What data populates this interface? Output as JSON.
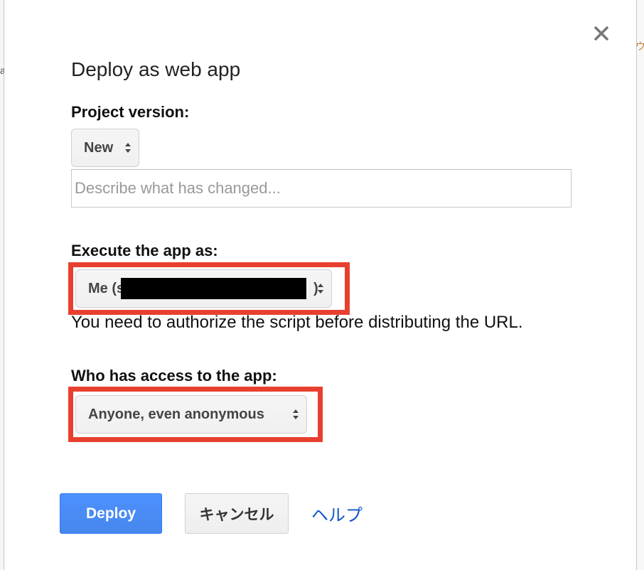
{
  "dialog": {
    "title": "Deploy as web app",
    "close_icon": "close-icon"
  },
  "project_version": {
    "label": "Project version:",
    "select_value": "New",
    "description_placeholder": "Describe what has changed...",
    "description_value": ""
  },
  "execute_as": {
    "label": "Execute the app as:",
    "select_value": "Me (s",
    "select_value_suffix": ")",
    "redacted": true,
    "note": "You need to authorize the script before distributing the URL."
  },
  "access": {
    "label": "Who has access to the app:",
    "select_value": "Anyone, even anonymous"
  },
  "buttons": {
    "deploy_label": "Deploy",
    "cancel_label": "キャンセル",
    "help_label": "ヘルプ"
  },
  "colors": {
    "primary_button": "#4d90fe",
    "highlight_box": "#e8402f",
    "link": "#1155cc"
  },
  "background_marks": {
    "right_top": "ウ",
    "left_top": "a"
  }
}
